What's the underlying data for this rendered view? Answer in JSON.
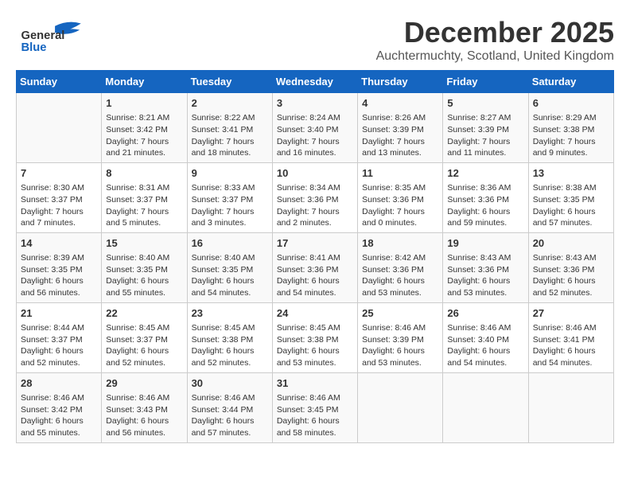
{
  "header": {
    "logo_line1": "General",
    "logo_line2": "Blue",
    "month": "December 2025",
    "location": "Auchtermuchty, Scotland, United Kingdom"
  },
  "days_of_week": [
    "Sunday",
    "Monday",
    "Tuesday",
    "Wednesday",
    "Thursday",
    "Friday",
    "Saturday"
  ],
  "weeks": [
    [
      {
        "day": "",
        "content": ""
      },
      {
        "day": "1",
        "content": "Sunrise: 8:21 AM\nSunset: 3:42 PM\nDaylight: 7 hours\nand 21 minutes."
      },
      {
        "day": "2",
        "content": "Sunrise: 8:22 AM\nSunset: 3:41 PM\nDaylight: 7 hours\nand 18 minutes."
      },
      {
        "day": "3",
        "content": "Sunrise: 8:24 AM\nSunset: 3:40 PM\nDaylight: 7 hours\nand 16 minutes."
      },
      {
        "day": "4",
        "content": "Sunrise: 8:26 AM\nSunset: 3:39 PM\nDaylight: 7 hours\nand 13 minutes."
      },
      {
        "day": "5",
        "content": "Sunrise: 8:27 AM\nSunset: 3:39 PM\nDaylight: 7 hours\nand 11 minutes."
      },
      {
        "day": "6",
        "content": "Sunrise: 8:29 AM\nSunset: 3:38 PM\nDaylight: 7 hours\nand 9 minutes."
      }
    ],
    [
      {
        "day": "7",
        "content": "Sunrise: 8:30 AM\nSunset: 3:37 PM\nDaylight: 7 hours\nand 7 minutes."
      },
      {
        "day": "8",
        "content": "Sunrise: 8:31 AM\nSunset: 3:37 PM\nDaylight: 7 hours\nand 5 minutes."
      },
      {
        "day": "9",
        "content": "Sunrise: 8:33 AM\nSunset: 3:37 PM\nDaylight: 7 hours\nand 3 minutes."
      },
      {
        "day": "10",
        "content": "Sunrise: 8:34 AM\nSunset: 3:36 PM\nDaylight: 7 hours\nand 2 minutes."
      },
      {
        "day": "11",
        "content": "Sunrise: 8:35 AM\nSunset: 3:36 PM\nDaylight: 7 hours\nand 0 minutes."
      },
      {
        "day": "12",
        "content": "Sunrise: 8:36 AM\nSunset: 3:36 PM\nDaylight: 6 hours\nand 59 minutes."
      },
      {
        "day": "13",
        "content": "Sunrise: 8:38 AM\nSunset: 3:35 PM\nDaylight: 6 hours\nand 57 minutes."
      }
    ],
    [
      {
        "day": "14",
        "content": "Sunrise: 8:39 AM\nSunset: 3:35 PM\nDaylight: 6 hours\nand 56 minutes."
      },
      {
        "day": "15",
        "content": "Sunrise: 8:40 AM\nSunset: 3:35 PM\nDaylight: 6 hours\nand 55 minutes."
      },
      {
        "day": "16",
        "content": "Sunrise: 8:40 AM\nSunset: 3:35 PM\nDaylight: 6 hours\nand 54 minutes."
      },
      {
        "day": "17",
        "content": "Sunrise: 8:41 AM\nSunset: 3:36 PM\nDaylight: 6 hours\nand 54 minutes."
      },
      {
        "day": "18",
        "content": "Sunrise: 8:42 AM\nSunset: 3:36 PM\nDaylight: 6 hours\nand 53 minutes."
      },
      {
        "day": "19",
        "content": "Sunrise: 8:43 AM\nSunset: 3:36 PM\nDaylight: 6 hours\nand 53 minutes."
      },
      {
        "day": "20",
        "content": "Sunrise: 8:43 AM\nSunset: 3:36 PM\nDaylight: 6 hours\nand 52 minutes."
      }
    ],
    [
      {
        "day": "21",
        "content": "Sunrise: 8:44 AM\nSunset: 3:37 PM\nDaylight: 6 hours\nand 52 minutes."
      },
      {
        "day": "22",
        "content": "Sunrise: 8:45 AM\nSunset: 3:37 PM\nDaylight: 6 hours\nand 52 minutes."
      },
      {
        "day": "23",
        "content": "Sunrise: 8:45 AM\nSunset: 3:38 PM\nDaylight: 6 hours\nand 52 minutes."
      },
      {
        "day": "24",
        "content": "Sunrise: 8:45 AM\nSunset: 3:38 PM\nDaylight: 6 hours\nand 53 minutes."
      },
      {
        "day": "25",
        "content": "Sunrise: 8:46 AM\nSunset: 3:39 PM\nDaylight: 6 hours\nand 53 minutes."
      },
      {
        "day": "26",
        "content": "Sunrise: 8:46 AM\nSunset: 3:40 PM\nDaylight: 6 hours\nand 54 minutes."
      },
      {
        "day": "27",
        "content": "Sunrise: 8:46 AM\nSunset: 3:41 PM\nDaylight: 6 hours\nand 54 minutes."
      }
    ],
    [
      {
        "day": "28",
        "content": "Sunrise: 8:46 AM\nSunset: 3:42 PM\nDaylight: 6 hours\nand 55 minutes."
      },
      {
        "day": "29",
        "content": "Sunrise: 8:46 AM\nSunset: 3:43 PM\nDaylight: 6 hours\nand 56 minutes."
      },
      {
        "day": "30",
        "content": "Sunrise: 8:46 AM\nSunset: 3:44 PM\nDaylight: 6 hours\nand 57 minutes."
      },
      {
        "day": "31",
        "content": "Sunrise: 8:46 AM\nSunset: 3:45 PM\nDaylight: 6 hours\nand 58 minutes."
      },
      {
        "day": "",
        "content": ""
      },
      {
        "day": "",
        "content": ""
      },
      {
        "day": "",
        "content": ""
      }
    ]
  ]
}
